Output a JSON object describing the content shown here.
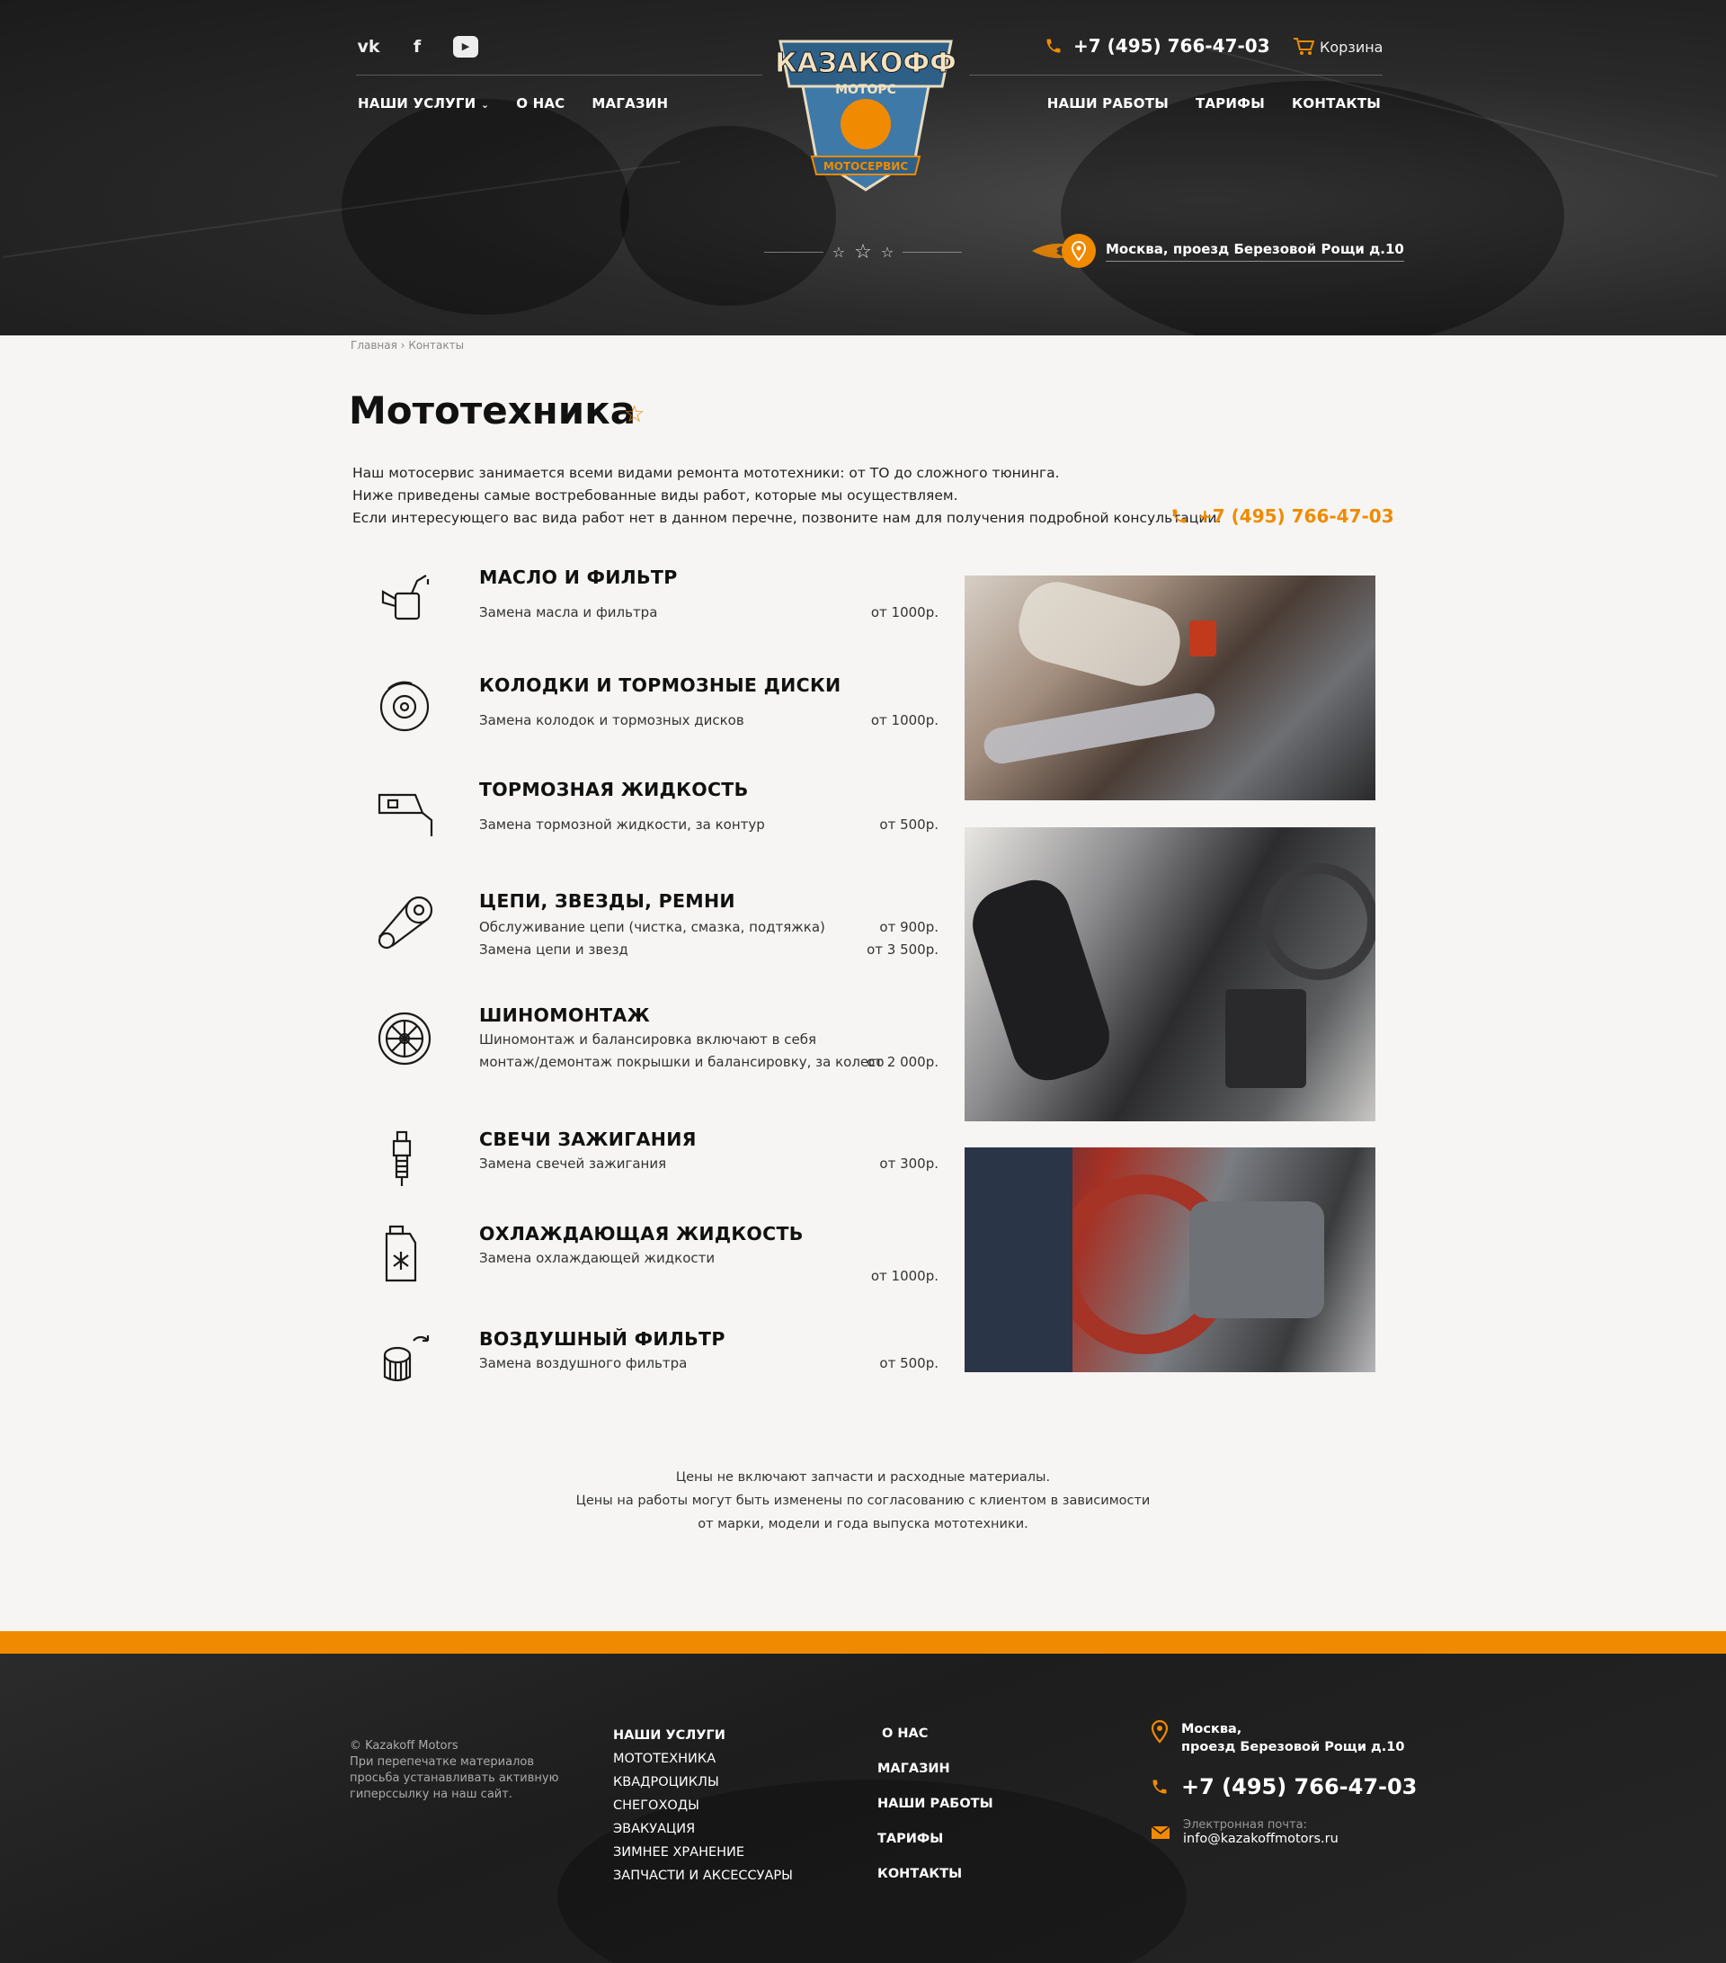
{
  "header": {
    "social": [
      "vk",
      "f",
      "▶"
    ],
    "nav_left": [
      {
        "label": "НАШИ УСЛУГИ",
        "dropdown": "⌄"
      },
      {
        "label": "О НАС"
      },
      {
        "label": "МАГАЗИН"
      }
    ],
    "nav_right": [
      {
        "label": "НАШИ РАБОТЫ"
      },
      {
        "label": "ТАРИФЫ"
      },
      {
        "label": "КОНТАКТЫ"
      }
    ],
    "phone": "+7 (495) 766-47-03",
    "cart_label": "Корзина",
    "address": "Москва, проезд Березовой Рощи д.10",
    "logo_top": "КАЗАКОФФ",
    "logo_mid": "МОТОРС",
    "logo_bottom": "МОТОСЕРВИС",
    "stars": [
      "☆",
      "☆",
      "☆"
    ]
  },
  "breadcrumb": {
    "home": "Главная",
    "sep": "›",
    "current": "Контакты"
  },
  "page": {
    "title": "Мототехника",
    "title_star": "☆",
    "intro": [
      "Наш мотосервис занимается всеми видами ремонта мототехники: от ТО до сложного тюнинга.",
      "Ниже приведены самые востребованные виды работ, которые мы осуществляем.",
      "Если интересующего вас вида работ нет в данном перечне, позвоните нам для получения подробной консультации."
    ],
    "phone": "+7 (495) 766-47-03"
  },
  "services": [
    {
      "icon": "oil-can-icon",
      "name": "МАСЛО И ФИЛЬТР",
      "lines": [
        {
          "text": "Замена масла и фильтра",
          "price": "от 1000р."
        }
      ]
    },
    {
      "icon": "brake-disc-icon",
      "name": "КОЛОДКИ И ТОРМОЗНЫЕ ДИСКИ",
      "lines": [
        {
          "text": "Замена колодок и тормозных дисков",
          "price": "от 1000р."
        }
      ]
    },
    {
      "icon": "brake-fluid-icon",
      "name": "ТОРМОЗНАЯ ЖИДКОСТЬ",
      "lines": [
        {
          "text": "Замена тормозной жидкости, за контур",
          "price": "от 500р."
        }
      ]
    },
    {
      "icon": "chain-sprocket-icon",
      "name": "ЦЕПИ, ЗВЕЗДЫ, РЕМНИ",
      "lines": [
        {
          "text": "Обслуживание цепи (чистка, смазка, подтяжка)",
          "price": "от 900р."
        },
        {
          "text": "Замена цепи и звезд",
          "price": "от 3 500р."
        }
      ]
    },
    {
      "icon": "wheel-icon",
      "name": "ШИНОМОНТАЖ",
      "lines": [
        {
          "text": "Шиномонтаж и балансировка включают в себя",
          "price": ""
        },
        {
          "text": "монтаж/демонтаж покрышки и балансировку, за колесо",
          "price": "от 2 000р."
        }
      ]
    },
    {
      "icon": "spark-plug-icon",
      "name": "СВЕЧИ ЗАЖИГАНИЯ",
      "lines": [
        {
          "text": "Замена свечей зажигания",
          "price": "от 300р."
        }
      ]
    },
    {
      "icon": "coolant-icon",
      "name": "ОХЛАЖДАЮЩАЯ ЖИДКОСТЬ",
      "lines": [
        {
          "text": "Замена охлаждающей жидкости",
          "price": ""
        },
        {
          "text": "",
          "price": "от 1000р."
        }
      ]
    },
    {
      "icon": "air-filter-icon",
      "name": "ВОЗДУШНЫЙ ФИЛЬТР",
      "lines": [
        {
          "text": "Замена воздушного фильтра",
          "price": "от 500р."
        }
      ]
    }
  ],
  "note": [
    "Цены не включают запчасти и расходные материалы.",
    "Цены на работы могут быть изменены по согласованию с клиентом в зависимости",
    "от марки, модели и года выпуска мототехники."
  ],
  "footer": {
    "copyright": [
      "© Kazakoff Motors",
      "При перепечатке материалов",
      "просьба устанавливать активную",
      "гиперссылку на наш сайт."
    ],
    "services_head": "НАШИ УСЛУГИ",
    "services": [
      "МОТОТЕХНИКА",
      "КВАДРОЦИКЛЫ",
      "СНЕГОХОДЫ",
      "ЭВАКУАЦИЯ",
      "ЗИМНЕЕ ХРАНЕНИЕ",
      "ЗАПЧАСТИ И АКСЕССУАРЫ"
    ],
    "links": [
      " О НАС",
      "МАГАЗИН",
      "НАШИ РАБОТЫ",
      "ТАРИФЫ",
      "КОНТАКТЫ"
    ],
    "address_line1": "Москва,",
    "address_line2": "проезд Березовой Рощи д.10",
    "phone": "+7 (495) 766-47-03",
    "email_label": "Электронная почта:",
    "email": "info@kazakoffmotors.ru"
  },
  "colors": {
    "accent": "#f08a00",
    "dark": "#1f1f1f",
    "text": "#222222"
  }
}
